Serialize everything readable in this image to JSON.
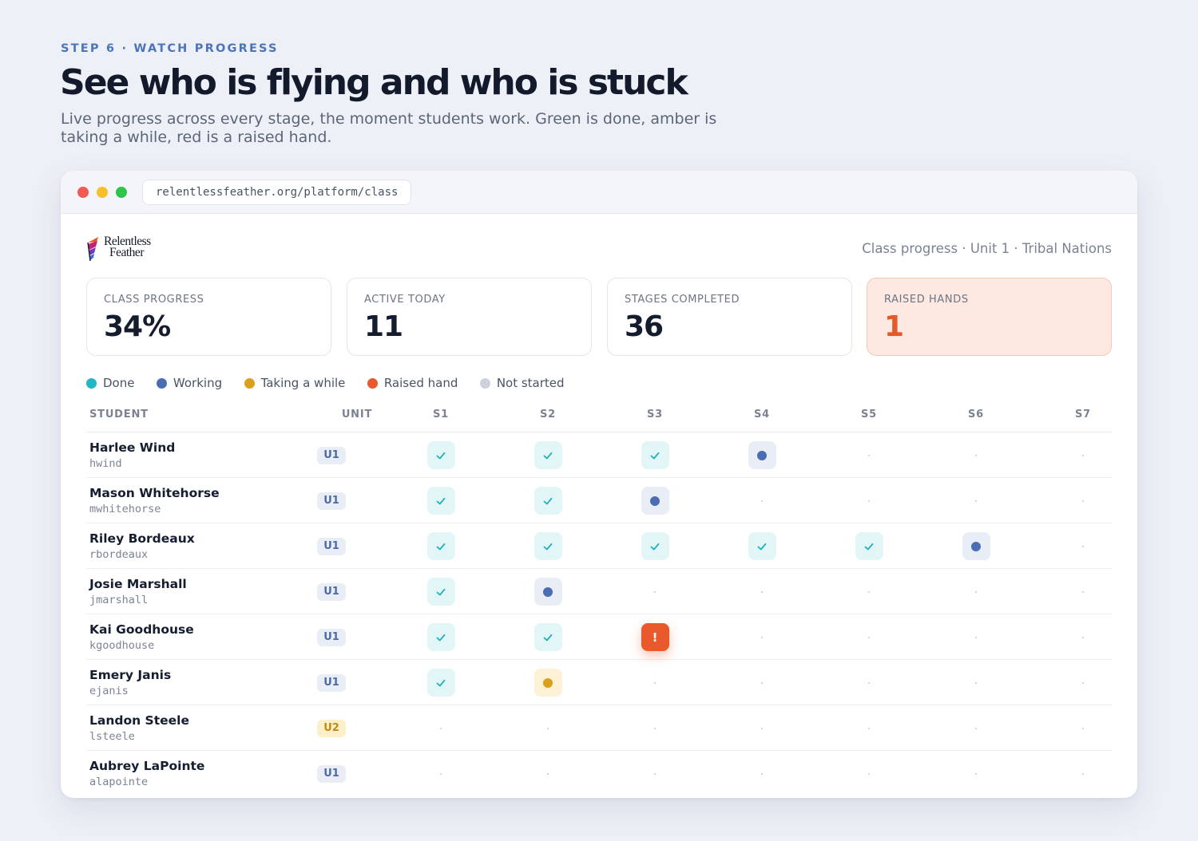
{
  "header": {
    "eyebrow": "STEP 6 · WATCH PROGRESS",
    "headline": "See who is flying and who is stuck",
    "subtitle": "Live progress across every stage, the moment students work. Green is done, amber is taking a while, red is a raised hand."
  },
  "browser": {
    "url": "relentlessfeather.org/platform/class"
  },
  "app": {
    "logo_line1": "Relentless",
    "logo_line2": "Feather",
    "breadcrumb": "Class progress · Unit 1 · Tribal Nations"
  },
  "stats": [
    {
      "label": "CLASS PROGRESS",
      "value": "34%"
    },
    {
      "label": "ACTIVE TODAY",
      "value": "11"
    },
    {
      "label": "STAGES COMPLETED",
      "value": "36"
    },
    {
      "label": "RAISED HANDS",
      "value": "1"
    }
  ],
  "legend": [
    {
      "label": "Done",
      "color": "#1fb8c3"
    },
    {
      "label": "Working",
      "color": "#4a6db4"
    },
    {
      "label": "Taking a while",
      "color": "#d9a11c"
    },
    {
      "label": "Raised hand",
      "color": "#e9592c"
    },
    {
      "label": "Not started",
      "color": "#ccd1dc"
    }
  ],
  "table": {
    "columns": [
      "STUDENT",
      "UNIT",
      "S1",
      "S2",
      "S3",
      "S4",
      "S5",
      "S6",
      "S7"
    ],
    "rows": [
      {
        "name": "Harlee Wind",
        "username": "hwind",
        "unit": "U1",
        "stages": [
          "done",
          "done",
          "done",
          "working",
          "none",
          "none",
          "none"
        ]
      },
      {
        "name": "Mason Whitehorse",
        "username": "mwhitehorse",
        "unit": "U1",
        "stages": [
          "done",
          "done",
          "working",
          "none",
          "none",
          "none",
          "none"
        ]
      },
      {
        "name": "Riley Bordeaux",
        "username": "rbordeaux",
        "unit": "U1",
        "stages": [
          "done",
          "done",
          "done",
          "done",
          "done",
          "working",
          "none"
        ]
      },
      {
        "name": "Josie Marshall",
        "username": "jmarshall",
        "unit": "U1",
        "stages": [
          "done",
          "working",
          "none",
          "none",
          "none",
          "none",
          "none"
        ]
      },
      {
        "name": "Kai Goodhouse",
        "username": "kgoodhouse",
        "unit": "U1",
        "stages": [
          "done",
          "done",
          "raised",
          "none",
          "none",
          "none",
          "none"
        ]
      },
      {
        "name": "Emery Janis",
        "username": "ejanis",
        "unit": "U1",
        "stages": [
          "done",
          "slow",
          "none",
          "none",
          "none",
          "none",
          "none"
        ]
      },
      {
        "name": "Landon Steele",
        "username": "lsteele",
        "unit": "U2",
        "stages": [
          "none",
          "none",
          "none",
          "none",
          "none",
          "none",
          "none"
        ]
      },
      {
        "name": "Aubrey LaPointe",
        "username": "alapointe",
        "unit": "U1",
        "stages": [
          "none",
          "none",
          "none",
          "none",
          "none",
          "none",
          "none"
        ]
      }
    ]
  },
  "icons": {
    "done": "check-icon",
    "working": "dot-icon",
    "slow": "dot-icon",
    "raised": "exclamation-icon",
    "none": "tiny-dot-icon"
  },
  "raised_glyph": "!"
}
